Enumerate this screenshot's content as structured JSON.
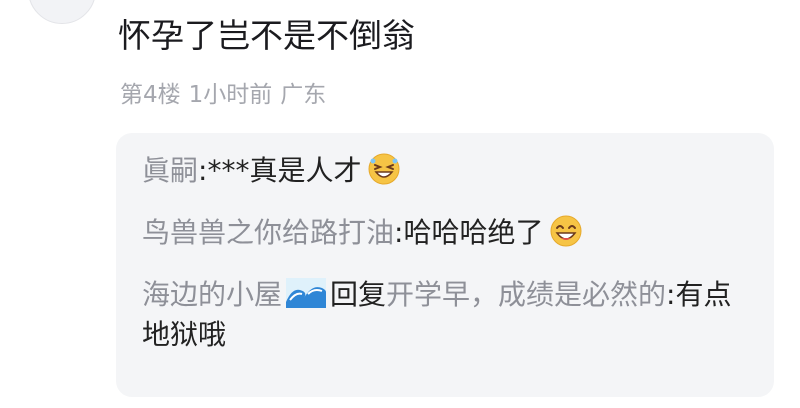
{
  "comment": {
    "text": "怀孕了岂不是不倒翁",
    "floor": "第4楼",
    "time": "1小时前",
    "location": "广东"
  },
  "replies": [
    {
      "author": "眞嗣",
      "separator": ":",
      "content": "***真是人才",
      "emoji": "grinning-face-emoji"
    },
    {
      "author": "鸟兽兽之你给路打油",
      "separator": ":",
      "content": "哈哈哈绝了",
      "emoji": "grinning-face-emoji"
    },
    {
      "author": "海边的小屋",
      "author_icon": "wave-emoji",
      "reply_keyword": "回复",
      "target": "开学早，成绩是必然的",
      "separator": ":",
      "content": "有点地狱哦"
    }
  ],
  "colors": {
    "name_gray": "#8e9098",
    "meta_gray": "#a5a7ae",
    "box_bg": "#f4f5f7"
  }
}
